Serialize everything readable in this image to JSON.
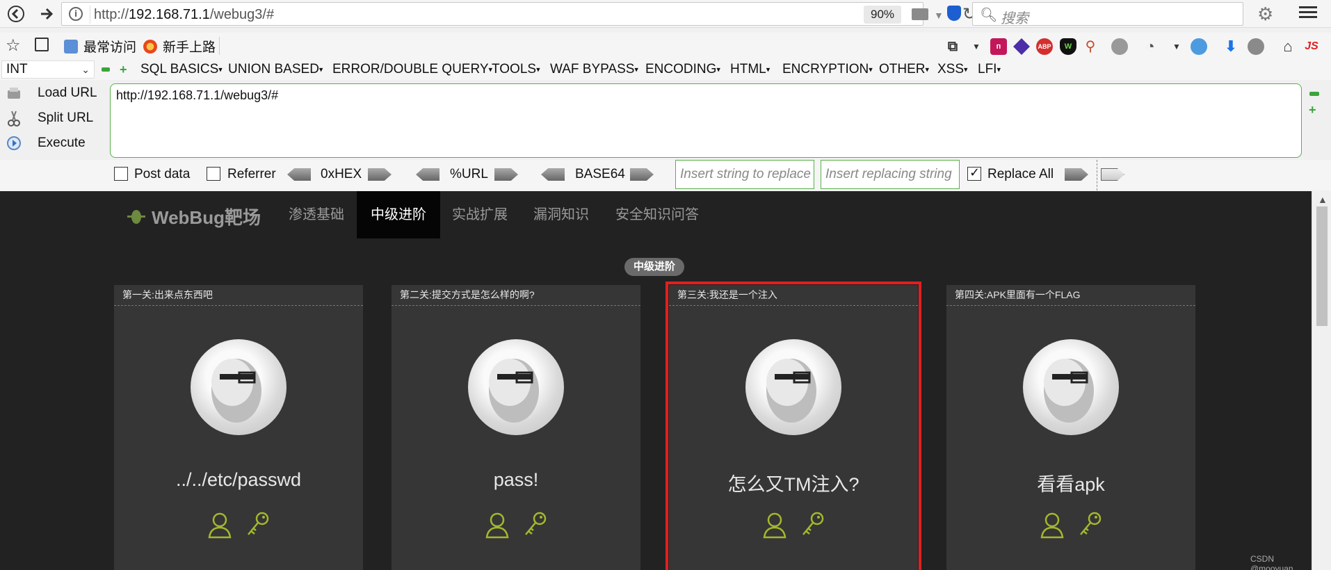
{
  "browser": {
    "url_prefix": "http://",
    "url_host": "192.168.71.1",
    "url_path": "/webug3/#",
    "zoom": "90%",
    "search_placeholder": "搜索"
  },
  "bookmarks": {
    "items": [
      {
        "label": "最常访问",
        "icon": "bookmark-folder-icon"
      },
      {
        "label": "新手上路",
        "icon": "firefox-icon"
      }
    ]
  },
  "hackbar": {
    "select_value": "INT",
    "menus": [
      "SQL BASICS",
      "UNION BASED",
      "ERROR/DOUBLE QUERY",
      "TOOLS",
      "WAF BYPASS",
      "ENCODING",
      "HTML",
      "ENCRYPTION",
      "OTHER",
      "XSS",
      "LFI"
    ],
    "actions": {
      "load": "Load URL",
      "split": "Split URL",
      "execute": "Execute"
    },
    "textarea_value": "http://192.168.71.1/webug3/#",
    "options": {
      "post_data": "Post data",
      "referrer": "Referrer",
      "hex": "0xHEX",
      "url": "%URL",
      "base64": "BASE64",
      "replace_placeholder": "Insert string to replace",
      "replacing_placeholder": "Insert replacing string",
      "replace_all": "Replace All"
    }
  },
  "site": {
    "brand": "WebBug靶场",
    "nav": [
      "渗透基础",
      "中级进阶",
      "实战扩展",
      "漏洞知识",
      "安全知识问答"
    ],
    "active_nav": "中级进阶",
    "section_badge": "中级进阶",
    "cards": [
      {
        "title": "第一关:出来点东西吧",
        "name": "../../etc/passwd"
      },
      {
        "title": "第二关:提交方式是怎么样的啊?",
        "name": "pass!"
      },
      {
        "title": "第三关:我还是一个注入",
        "name": "怎么又TM注入?"
      },
      {
        "title": "第四关:APK里面有一个FLAG",
        "name": "看看apk"
      }
    ],
    "accent_color": "#a4b82c",
    "highlight_color": "#e21f1f"
  },
  "watermark": "CSDN @mooyuan"
}
